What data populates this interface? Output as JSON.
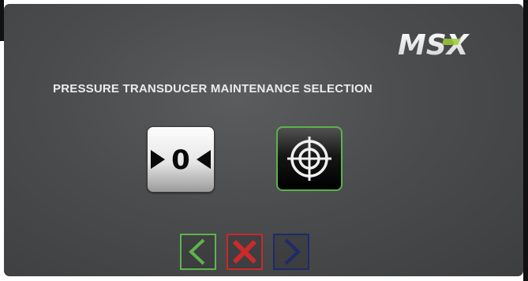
{
  "brand": {
    "logo_text": "MSX",
    "logo_color": "#ffffff",
    "logo_accent": "#9ccb3b"
  },
  "screen": {
    "title": "PRESSURE TRANSDUCER MAINTENANCE SELECTION"
  },
  "options": {
    "zero": {
      "icon": "zero-calibration-icon",
      "glyph": "0"
    },
    "target": {
      "icon": "crosshair-target-icon",
      "selected": true,
      "selected_color": "#5bb34a"
    }
  },
  "navigation": {
    "back": {
      "icon": "chevron-left-icon",
      "color": "#5fb44c"
    },
    "cancel": {
      "icon": "close-icon",
      "color": "#c92a2a"
    },
    "next": {
      "icon": "chevron-right-icon",
      "color": "#1e2a6a"
    }
  }
}
